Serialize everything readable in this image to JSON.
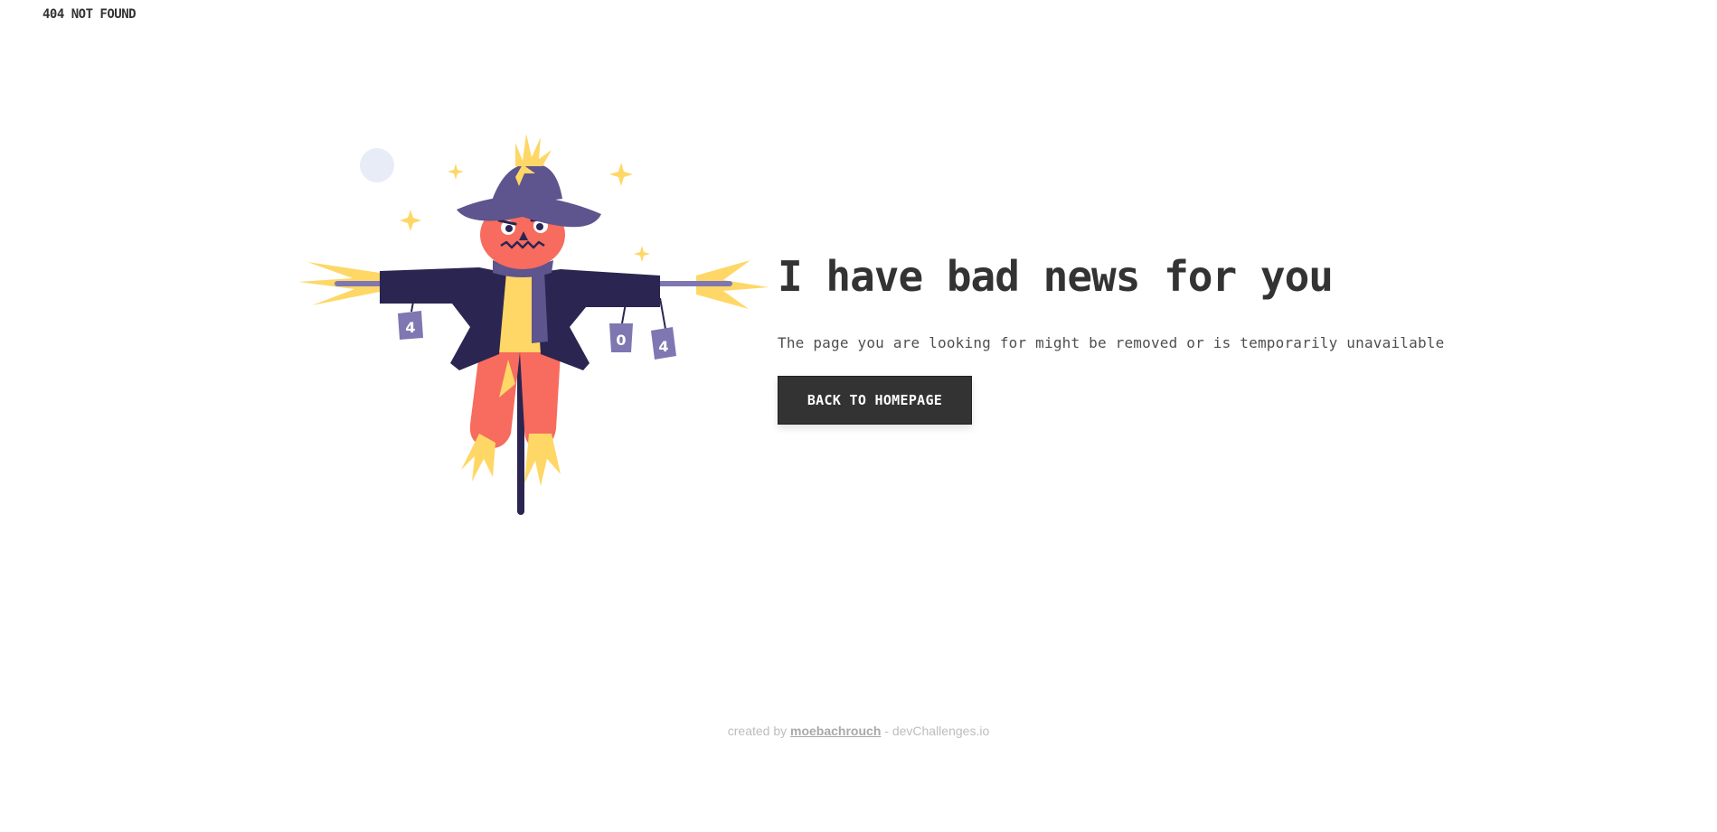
{
  "brand": {
    "title": "404 NOT FOUND"
  },
  "main": {
    "headline": "I have bad news for you",
    "description": "The page you are looking for might be removed or is temporarily unavailable",
    "button_label": "BACK TO HOMEPAGE"
  },
  "illustration": {
    "can_labels": [
      "4",
      "0",
      "4"
    ]
  },
  "footer": {
    "prefix": "created by",
    "author": "moebachrouch",
    "suffix": "- devChallenges.io"
  },
  "colors": {
    "text": "#333333",
    "button_bg": "#333333",
    "button_text": "#FFFFFF",
    "coat": "#2B2552",
    "hat": "#5E548E",
    "head": "#F76C5E",
    "straw": "#FED766",
    "can": "#7F77B1"
  }
}
